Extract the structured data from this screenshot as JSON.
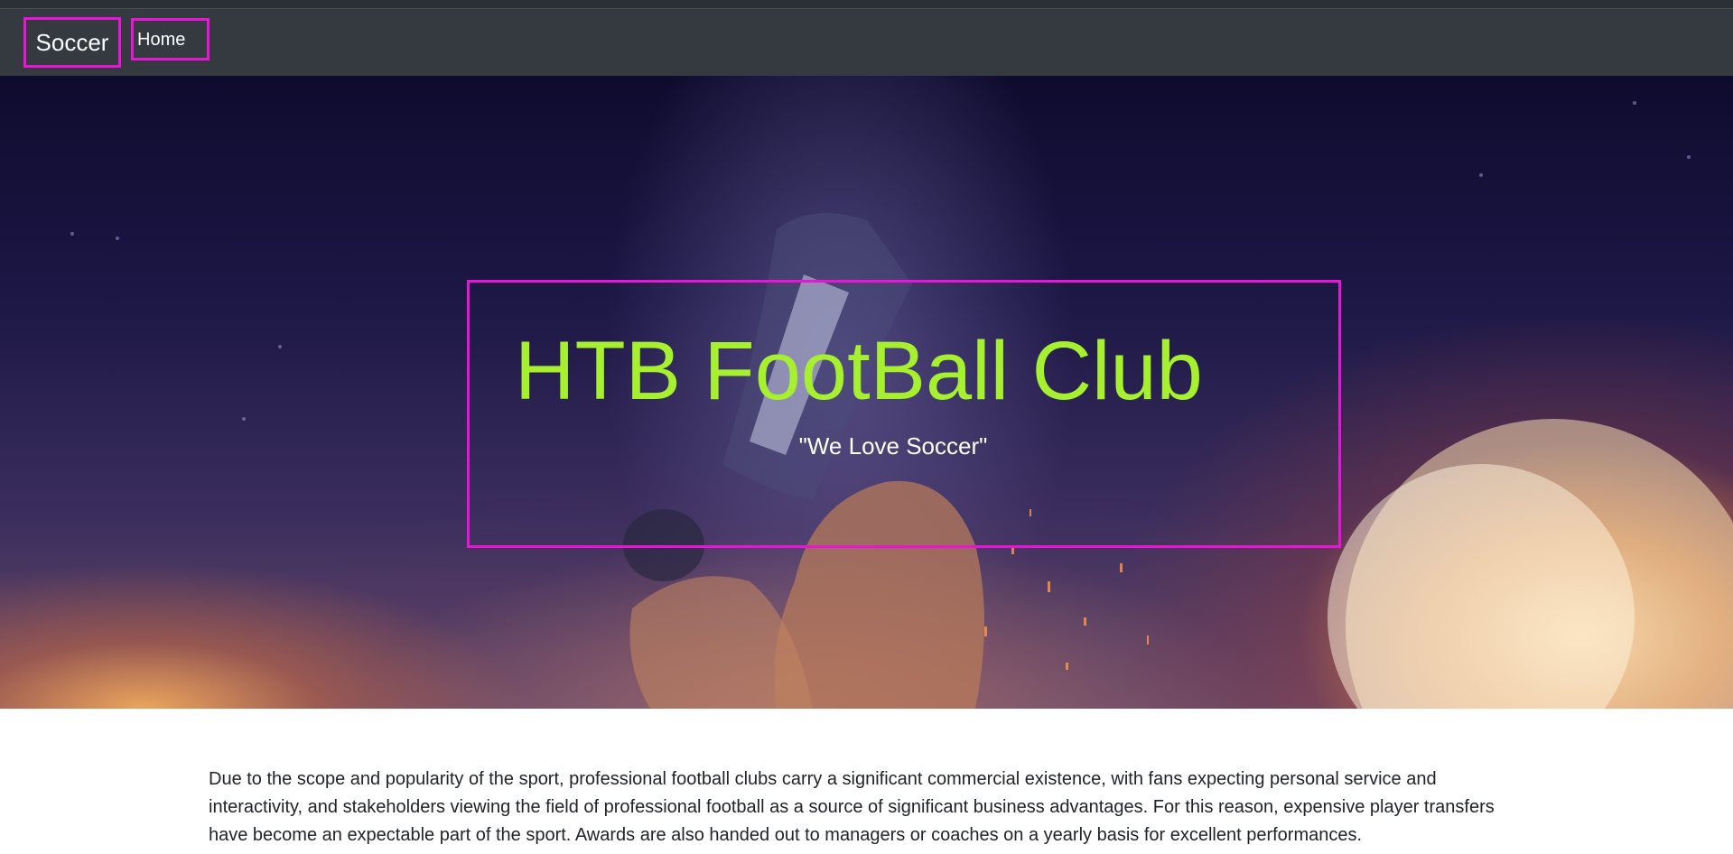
{
  "navbar": {
    "brand": "Soccer",
    "links": [
      {
        "label": "Home"
      }
    ]
  },
  "hero": {
    "title": "HTB FootBall Club",
    "subtitle": "\"We Love Soccer\"",
    "colors": {
      "title": "#a6f02f",
      "highlight_border": "#e815d6"
    }
  },
  "content": {
    "paragraph": "Due to the scope and popularity of the sport, professional football clubs carry a significant commercial existence, with fans expecting personal service and interactivity, and stakeholders viewing the field of professional football as a source of significant business advantages. For this reason, expensive player transfers have become an expectable part of the sport. Awards are also handed out to managers or coaches on a yearly basis for excellent performances."
  }
}
